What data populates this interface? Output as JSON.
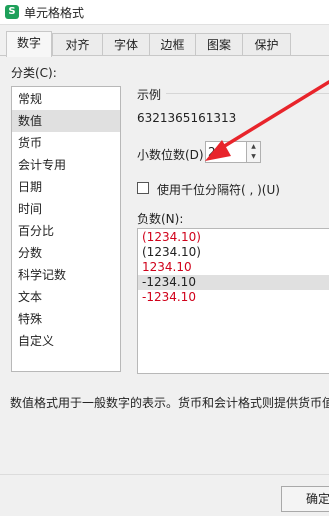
{
  "window": {
    "title": "单元格格式",
    "app_icon_letter": "S"
  },
  "tabs": [
    {
      "label": "数字",
      "active": true
    },
    {
      "label": "对齐",
      "active": false
    },
    {
      "label": "字体",
      "active": false
    },
    {
      "label": "边框",
      "active": false
    },
    {
      "label": "图案",
      "active": false
    },
    {
      "label": "保护",
      "active": false
    }
  ],
  "category": {
    "label": "分类(C):",
    "items": [
      "常规",
      "数值",
      "货币",
      "会计专用",
      "日期",
      "时间",
      "百分比",
      "分数",
      "科学记数",
      "文本",
      "特殊",
      "自定义"
    ],
    "selected": "数值"
  },
  "sample": {
    "label": "示例",
    "value": "6321365161313"
  },
  "decimal": {
    "label": "小数位数(D):",
    "value": "2"
  },
  "thousands": {
    "label": "使用千位分隔符( , )(U)",
    "checked": false
  },
  "negative": {
    "label": "负数(N):",
    "items": [
      {
        "text": "(1234.10)",
        "color": "#d0021b",
        "selected": false
      },
      {
        "text": "(1234.10)",
        "color": "#222222",
        "selected": false
      },
      {
        "text": "1234.10",
        "color": "#d0021b",
        "selected": false
      },
      {
        "text": "-1234.10",
        "color": "#222222",
        "selected": true
      },
      {
        "text": "-1234.10",
        "color": "#d0021b",
        "selected": false
      }
    ]
  },
  "description": "数值格式用于一般数字的表示。货币和会计格式则提供货币值",
  "buttons": {
    "ok": "确定"
  },
  "colors": {
    "annotation_arrow": "#e8242b",
    "negative_red": "#d0021b",
    "app_icon_green": "#1ea05a"
  }
}
